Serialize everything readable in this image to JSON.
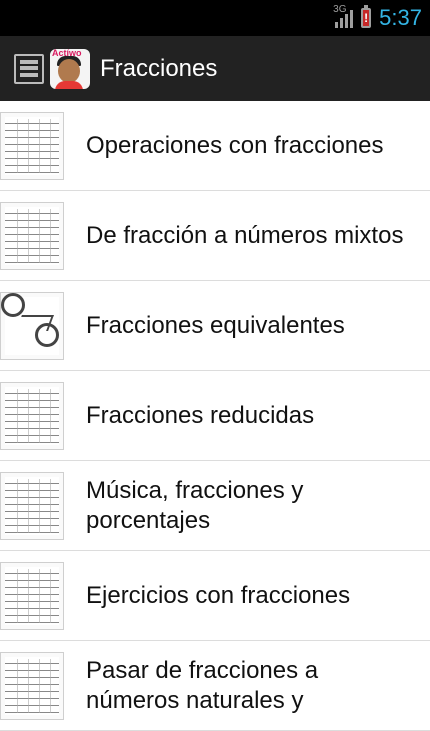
{
  "status_bar": {
    "network": "3G",
    "time": "5:37",
    "battery_alert": "!"
  },
  "action_bar": {
    "title": "Fracciones",
    "app_logo_text": "Actíwo"
  },
  "list": {
    "items": [
      {
        "label": "Operaciones con fracciones"
      },
      {
        "label": "De fracción a números mixtos"
      },
      {
        "label": "Fracciones equivalentes"
      },
      {
        "label": "Fracciones reducidas"
      },
      {
        "label": "Música, fracciones y porcentajes"
      },
      {
        "label": "Ejercicios con fracciones"
      },
      {
        "label": "Pasar de fracciones a números naturales y"
      }
    ]
  },
  "colors": {
    "status_time": "#33b5e5",
    "action_bar_bg": "#222222",
    "battery_alert": "#c62828"
  }
}
